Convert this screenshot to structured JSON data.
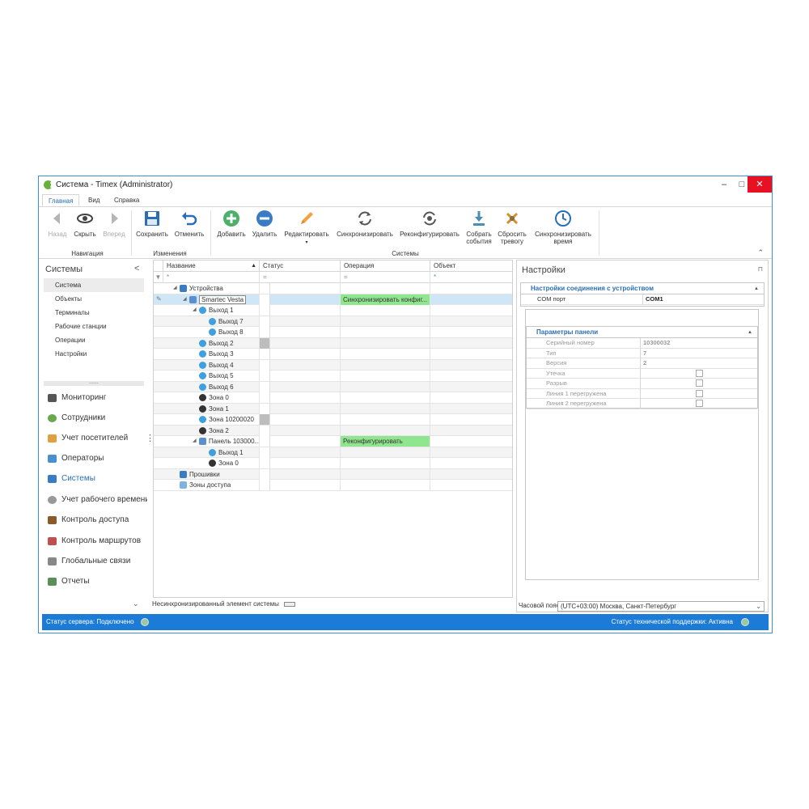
{
  "window": {
    "title": "Система - Timex (Administrator)",
    "min": "–",
    "max": "□",
    "close": "✕"
  },
  "ribbon": {
    "tabs": [
      "Главная",
      "Вид",
      "Справка"
    ],
    "nav": {
      "back": "Назад",
      "hide": "Скрыть",
      "forward": "Вперед",
      "group": "Навигация"
    },
    "edit": {
      "save": "Сохранить",
      "undo": "Отменить",
      "group": "Изменения"
    },
    "systems": {
      "add": "Добавить",
      "delete": "Удалить",
      "modify": "Редактировать",
      "sync": "Синхронизировать",
      "reconf": "Реконфигурировать",
      "collect1": "Собрать",
      "collect2": "события",
      "reset1": "Сбросить",
      "reset2": "тревогу",
      "synctime1": "Синхронизировать",
      "synctime2": "время",
      "group": "Системы"
    }
  },
  "leftnav": {
    "title": "Системы",
    "collapse": "<",
    "subitems": [
      "Система",
      "Объекты",
      "Терминалы",
      "Рабочие станции",
      "Операции",
      "Настройки"
    ],
    "grip": "......",
    "modules": [
      "Мониторинг",
      "Сотрудники",
      "Учет посетителей",
      "Операторы",
      "Системы",
      "Учет рабочего времени",
      "Контроль доступа",
      "Контроль маршрутов",
      "Глобальные связи",
      "Отчеты"
    ],
    "more": "⌄"
  },
  "grid": {
    "columns": [
      "Название",
      "Статус",
      "Операция",
      "Объект"
    ],
    "filter_marks": [
      "*",
      "=",
      "=",
      "*"
    ],
    "rows": [
      {
        "name": "Устройства",
        "op": ""
      },
      {
        "name": "Smartec Vesta",
        "op": "Синхронизировать конфиг..."
      },
      {
        "name": "Выход 1",
        "op": ""
      },
      {
        "name": "Выход 7",
        "op": ""
      },
      {
        "name": "Выход 8",
        "op": ""
      },
      {
        "name": "Выход 2",
        "op": ""
      },
      {
        "name": "Выход 3",
        "op": ""
      },
      {
        "name": "Выход 4",
        "op": ""
      },
      {
        "name": "Выход 5",
        "op": ""
      },
      {
        "name": "Выход 6",
        "op": ""
      },
      {
        "name": "Зона 0",
        "op": ""
      },
      {
        "name": "Зона 1",
        "op": ""
      },
      {
        "name": "Зона 10200020",
        "op": ""
      },
      {
        "name": "Зона 2",
        "op": ""
      },
      {
        "name": "Панель 103000...",
        "op": "Реконфигурировать"
      },
      {
        "name": "Выход 1",
        "op": ""
      },
      {
        "name": "Зона 0",
        "op": ""
      },
      {
        "name": "Прошивки",
        "op": ""
      },
      {
        "name": "Зоны доступа",
        "op": ""
      }
    ],
    "legend": "Несинхронизированный элемент системы"
  },
  "settings": {
    "title": "Настройки",
    "pin": "⊓",
    "connection": {
      "header": "Настройки соединения с устройством",
      "com_label": "COM порт",
      "com_value": "COM1"
    },
    "panel": {
      "header": "Параметры панели",
      "serial_label": "Серийный номер",
      "serial_value": "10300032",
      "type_label": "Тип",
      "type_value": "7",
      "version_label": "Версия",
      "version_value": "2",
      "leak_label": "Утечка",
      "break_label": "Разрыв",
      "line1_label": "Линия 1 перегружена",
      "line2_label": "Линия 2 перегружена"
    },
    "timezone_label": "Часовой пояс",
    "timezone_value": "(UTC+03:00) Москва, Санкт-Петербург"
  },
  "status": {
    "server": "Статус сервера: Подключено",
    "support": "Статус технической поддержки: Активна"
  },
  "colors": {
    "accent": "#1c7bd6",
    "operation_highlight": "#90e68f",
    "selection": "#cfe6f7"
  }
}
